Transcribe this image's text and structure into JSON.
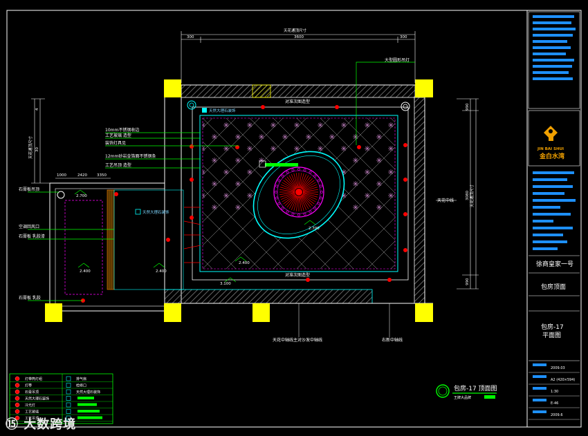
{
  "drawing": {
    "title": "包房-17 顶面图",
    "title_sub": "王牌大品牌",
    "overall_dim_label": "天花通顶尺寸",
    "top_dims": [
      "300",
      "3600",
      "300"
    ],
    "left_dims": [
      "4",
      "30",
      "20"
    ],
    "right_dims": [
      "990",
      "3080",
      "990"
    ],
    "left_axis_label": "天花通顶尺寸",
    "right_axis_label": "天花通顶尺寸",
    "bottom_dims": [
      "1000",
      "2420",
      "3350"
    ],
    "mid_label_top": "对准次图造型",
    "mid_label_bottom": "对准次图造型",
    "right_mid_label": "天花中线",
    "bottom_center_label": "天花中轴线主对沙发中轴线",
    "bottom_right_label": "右新中轴线",
    "top_right_note": "大型圆形吊灯",
    "heights": [
      "2.700",
      "2.700",
      "3.100",
      "2.400",
      "2.400",
      "2.400"
    ],
    "callouts_left": [
      "10mm不锈钢收边",
      "工艺玻璃 造型",
      "装饰灯具见"
    ],
    "callouts_left2": [
      "12mm砂岩金箔面不锈钢条",
      "工艺吊顶 造型"
    ],
    "callouts_far_left": [
      "石膏板吊顶",
      "空调回风口",
      "石膏板 乳胶漆",
      "石膏板 乳胶"
    ],
    "cyan_note_1": "天然大理石装饰",
    "cyan_note_2": "天然大理石装饰"
  },
  "legend": {
    "rows": [
      {
        "symbol": "筒灯",
        "text": "灯带筒灯组"
      },
      {
        "symbol": "灯带",
        "text": "灯带"
      },
      {
        "symbol": "射灯",
        "text": "石膏吊顶"
      },
      {
        "symbol": "吊灯",
        "text": "天然大理石装饰"
      },
      {
        "symbol": "开关",
        "text": "冷光灯"
      },
      {
        "symbol": "风口",
        "text": "工艺玻璃"
      },
      {
        "symbol": "插座",
        "text": "工艺吊顶"
      }
    ],
    "right": [
      "排气扇",
      "检修口",
      "天然大理石装饰",
      "",
      "",
      "",
      ""
    ]
  },
  "title_block": {
    "logo_text": "金白水湾",
    "logo_en": "JIN BAI SHUI",
    "project": "徐商皇家一号",
    "drawing_name": "包房顶面",
    "sheet": "包房-17",
    "sheet_sub": "平面图",
    "rows": [
      "2009.03",
      "A2 (420×594)",
      "1:30",
      "E-46",
      "2009.6"
    ]
  },
  "watermark": "大数跨境",
  "colors": {
    "background": "#000000",
    "cyan": "#00ffff",
    "yellow": "#ffff00",
    "green": "#00ff00",
    "magenta": "#ff00ff",
    "red": "#ff0000",
    "white": "#ffffff"
  }
}
